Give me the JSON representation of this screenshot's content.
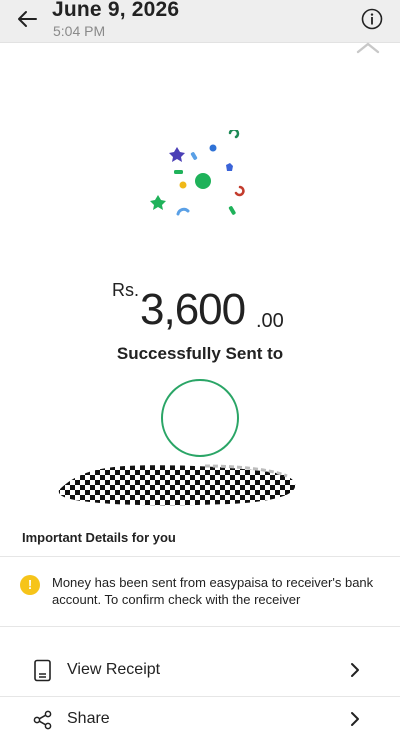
{
  "header": {
    "title": "June 9, 2026",
    "subtitle": "5:04 PM"
  },
  "transaction": {
    "currency": "Rs.",
    "amount_whole": "3,600",
    "amount_decimal": ".00",
    "status_text": "Successfully Sent to"
  },
  "details": {
    "title": "Important Details for you",
    "notice_icon_text": "!",
    "notice_text": "Money has been sent from easypaisa to receiver's bank account. To confirm check with the receiver"
  },
  "actions": [
    {
      "label": "View Receipt",
      "icon": "receipt-icon"
    },
    {
      "label": "Share",
      "icon": "share-icon"
    }
  ],
  "colors": {
    "accent_green": "#2aa566",
    "notice_yellow": "#f6c41a"
  }
}
